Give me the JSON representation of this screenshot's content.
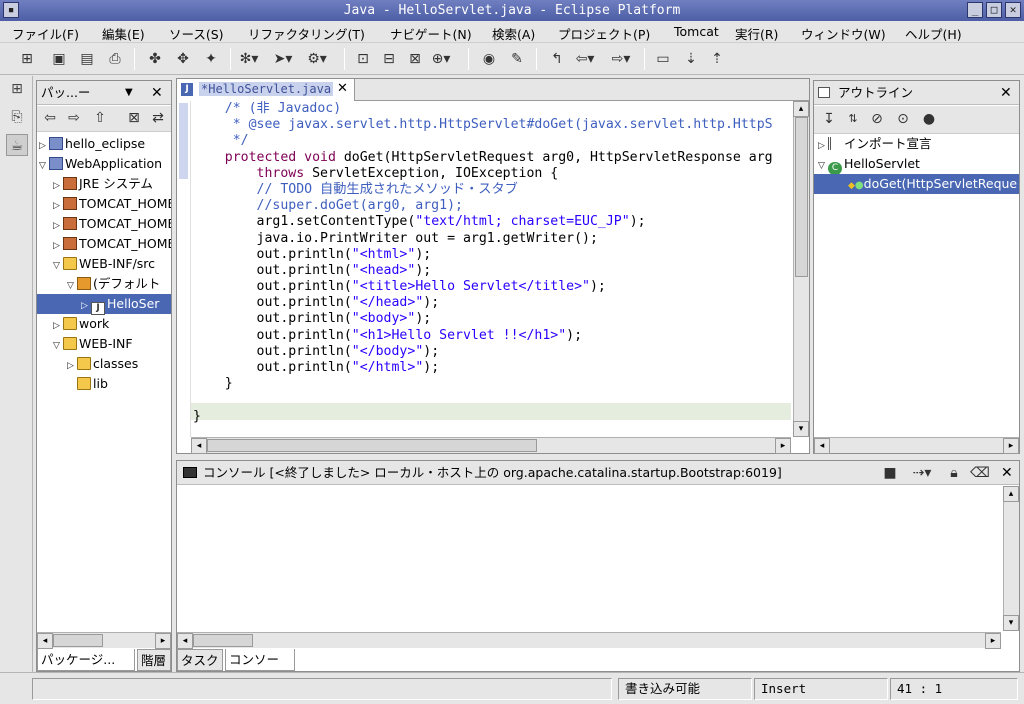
{
  "window": {
    "title": "Java - HelloServlet.java - Eclipse Platform"
  },
  "menu": [
    "ファイル(F)",
    "編集(E)",
    "ソース(S)",
    "リファクタリング(T)",
    "ナビゲート(N)",
    "検索(A)",
    "プロジェクト(P)",
    "Tomcat",
    "実行(R)",
    "ウィンドウ(W)",
    "ヘルプ(H)"
  ],
  "package_explorer": {
    "title": "パッ...ー",
    "items": [
      {
        "label": "hello_eclipse"
      },
      {
        "label": "WebApplication"
      },
      {
        "label": "JRE システム"
      },
      {
        "label": "TOMCAT_HOME/c"
      },
      {
        "label": "TOMCAT_HOME/c"
      },
      {
        "label": "TOMCAT_HOME/c"
      },
      {
        "label": "WEB-INF/src"
      },
      {
        "label": "(デフォルト"
      },
      {
        "label": "HelloSer"
      },
      {
        "label": "work"
      },
      {
        "label": "WEB-INF"
      },
      {
        "label": "classes"
      },
      {
        "label": "lib"
      }
    ],
    "tabs": [
      "パッケージ...",
      "階層"
    ]
  },
  "editor": {
    "tab": "*HelloServlet.java",
    "lines": [
      {
        "seg": [
          [
            "cm",
            "    /* (非 Javadoc)"
          ]
        ]
      },
      {
        "seg": [
          [
            "cm",
            "     * @see javax.servlet.http.HttpServlet#doGet(javax.servlet.http.HttpS"
          ]
        ]
      },
      {
        "seg": [
          [
            "cm",
            "     */"
          ]
        ]
      },
      {
        "seg": [
          [
            "kw",
            "    protected void "
          ],
          [
            "",
            "doGet(HttpServletRequest arg0, HttpServletResponse arg"
          ]
        ]
      },
      {
        "seg": [
          [
            "kw",
            "        throws "
          ],
          [
            "",
            "ServletException, IOException {"
          ]
        ]
      },
      {
        "seg": [
          [
            "cm",
            "        // TODO 自動生成されたメソッド・スタブ"
          ]
        ]
      },
      {
        "seg": [
          [
            "cm",
            "        //super.doGet(arg0, arg1);"
          ]
        ]
      },
      {
        "seg": [
          [
            "",
            "        arg1.setContentType("
          ],
          [
            "str",
            "\"text/html; charset=EUC_JP\""
          ],
          [
            "",
            ");"
          ]
        ]
      },
      {
        "seg": [
          [
            "",
            "        java.io.PrintWriter out = arg1.getWriter();"
          ]
        ]
      },
      {
        "seg": [
          [
            "",
            "        out.println("
          ],
          [
            "str",
            "\"<html>\""
          ],
          [
            "",
            ");"
          ]
        ]
      },
      {
        "seg": [
          [
            "",
            "        out.println("
          ],
          [
            "str",
            "\"<head>\""
          ],
          [
            "",
            ");"
          ]
        ]
      },
      {
        "seg": [
          [
            "",
            "        out.println("
          ],
          [
            "str",
            "\"<title>Hello Servlet</title>\""
          ],
          [
            "",
            ");"
          ]
        ]
      },
      {
        "seg": [
          [
            "",
            "        out.println("
          ],
          [
            "str",
            "\"</head>\""
          ],
          [
            "",
            ");"
          ]
        ]
      },
      {
        "seg": [
          [
            "",
            "        out.println("
          ],
          [
            "str",
            "\"<body>\""
          ],
          [
            "",
            ");"
          ]
        ]
      },
      {
        "seg": [
          [
            "",
            "        out.println("
          ],
          [
            "str",
            "\"<h1>Hello Servlet !!</h1>\""
          ],
          [
            "",
            ");"
          ]
        ]
      },
      {
        "seg": [
          [
            "",
            "        out.println("
          ],
          [
            "str",
            "\"</body>\""
          ],
          [
            "",
            ");"
          ]
        ]
      },
      {
        "seg": [
          [
            "",
            "        out.println("
          ],
          [
            "str",
            "\"</html>\""
          ],
          [
            "",
            ");"
          ]
        ]
      },
      {
        "seg": [
          [
            "",
            "    }"
          ]
        ]
      },
      {
        "seg": [
          [
            "",
            ""
          ]
        ]
      },
      {
        "seg": [
          [
            "",
            "}"
          ]
        ]
      }
    ]
  },
  "outline": {
    "title": "アウトライン",
    "items": [
      {
        "label": "インポート宣言"
      },
      {
        "label": "HelloServlet"
      },
      {
        "label": "doGet(HttpServletReque"
      }
    ]
  },
  "console": {
    "title": "コンソール [<終了しました> ローカル・ホスト上の org.apache.catalina.startup.Bootstrap:6019]",
    "tabs": [
      "タスク",
      "コンソール"
    ]
  },
  "status": {
    "writable": "書き込み可能",
    "mode": "Insert",
    "position": "41 : 1"
  }
}
